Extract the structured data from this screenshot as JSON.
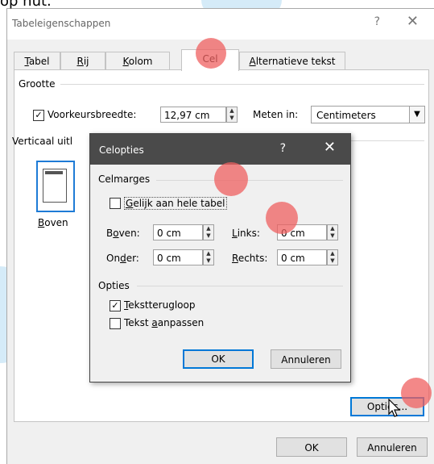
{
  "page_caption_fragment": "op nut.",
  "main_dialog": {
    "title": "Tabeleigenschappen",
    "help_glyph": "?",
    "close_glyph": "✕",
    "tabs": [
      {
        "label": "Tabel",
        "underline_char": "T"
      },
      {
        "label": "Rij",
        "underline_char": "R"
      },
      {
        "label": "Kolom",
        "underline_char": "K"
      },
      {
        "label": "Cel",
        "active": true
      },
      {
        "label": "Alternatieve tekst",
        "underline_char": "A"
      }
    ],
    "size_group": {
      "label": "Grootte",
      "preferred_width_checked": true,
      "preferred_width_label": "Voorkeursbreedte:",
      "preferred_width_value": "12,97 cm",
      "measure_in_label": "Meten in:",
      "measure_in_value": "Centimeters"
    },
    "vertical_alignment": {
      "label": "Verticaal uitl",
      "selected_option": "Boven"
    },
    "options_button": "Opties...",
    "ok_button": "OK",
    "cancel_button": "Annuleren"
  },
  "cell_options_dialog": {
    "title": "Celopties",
    "help_glyph": "?",
    "close_glyph": "✕",
    "margins_group": "Celmarges",
    "same_as_table_checked": false,
    "same_as_table_label": "Gelijk aan hele tabel",
    "top_label": "Boven:",
    "top_value": "0 cm",
    "left_label": "Links:",
    "left_value": "0 cm",
    "bottom_label": "Onder:",
    "bottom_value": "0 cm",
    "right_label": "Rechts:",
    "right_value": "0 cm",
    "options_group": "Opties",
    "wrap_text_checked": true,
    "wrap_text_label": "Tekstterugloop",
    "fit_text_checked": false,
    "fit_text_label": "Tekst aanpassen",
    "ok_button": "OK",
    "cancel_button": "Annuleren"
  },
  "colors": {
    "accent_highlight": "#ef6060",
    "background_shape": "#d5ebf8",
    "focus_blue": "#0078d7"
  }
}
